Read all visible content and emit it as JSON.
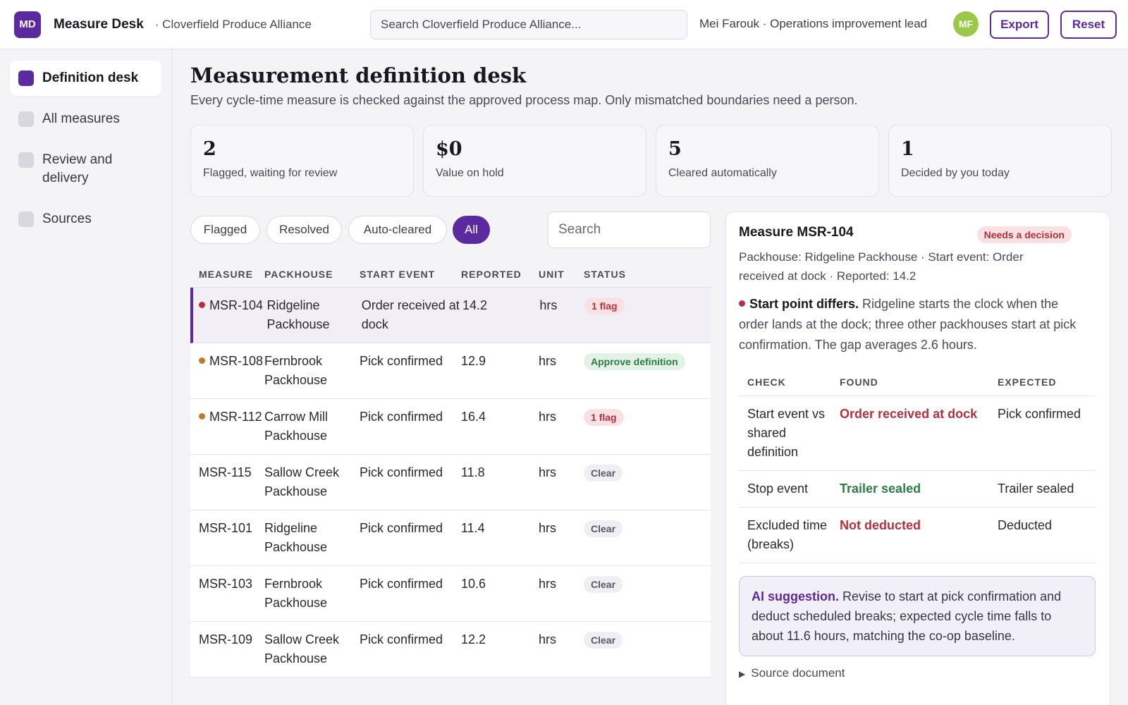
{
  "app": {
    "logo_text": "MD",
    "title": "Measure Desk",
    "org": "· Cloverfield Produce Alliance",
    "search_placeholder": "Search Cloverfield Produce Alliance...",
    "user": "Mei Farouk · Operations improvement lead",
    "avatar": "MF",
    "export_label": "Export",
    "reset_label": "Reset"
  },
  "sidebar": {
    "items": [
      {
        "label": "Definition desk",
        "active": true
      },
      {
        "label": "All measures",
        "active": false
      },
      {
        "label": "Review and delivery",
        "active": false
      },
      {
        "label": "Sources",
        "active": false
      }
    ]
  },
  "page": {
    "title": "Measurement definition desk",
    "subtitle": "Every cycle-time measure is checked against the approved process map. Only mismatched boundaries need a person."
  },
  "stats": [
    {
      "value": "2",
      "label": "Flagged, waiting for review"
    },
    {
      "value": "$0",
      "label": "Value on hold"
    },
    {
      "value": "5",
      "label": "Cleared automatically"
    },
    {
      "value": "1",
      "label": "Decided by you today"
    }
  ],
  "filters": {
    "chips": [
      "Flagged",
      "Resolved",
      "Auto-cleared",
      "All"
    ],
    "active": "All",
    "search_placeholder": "Search"
  },
  "table": {
    "headers": [
      "MEASURE",
      "PACKHOUSE",
      "START EVENT",
      "REPORTED",
      "UNIT",
      "STATUS"
    ],
    "rows": [
      {
        "measure": "MSR-104",
        "packhouse": "Ridgeline Packhouse",
        "start": "Order received at dock",
        "reported": "14.2",
        "unit": "hrs",
        "status": "1 flag",
        "status_kind": "flag",
        "dot": "red",
        "selected": true
      },
      {
        "measure": "MSR-108",
        "packhouse": "Fernbrook Packhouse",
        "start": "Pick confirmed",
        "reported": "12.9",
        "unit": "hrs",
        "status": "Approve definition",
        "status_kind": "approve",
        "dot": "amber",
        "selected": false
      },
      {
        "measure": "MSR-112",
        "packhouse": "Carrow Mill Packhouse",
        "start": "Pick confirmed",
        "reported": "16.4",
        "unit": "hrs",
        "status": "1 flag",
        "status_kind": "flag",
        "dot": "amber",
        "selected": false
      },
      {
        "measure": "MSR-115",
        "packhouse": "Sallow Creek Packhouse",
        "start": "Pick confirmed",
        "reported": "11.8",
        "unit": "hrs",
        "status": "Clear",
        "status_kind": "clear",
        "dot": "",
        "selected": false
      },
      {
        "measure": "MSR-101",
        "packhouse": "Ridgeline Packhouse",
        "start": "Pick confirmed",
        "reported": "11.4",
        "unit": "hrs",
        "status": "Clear",
        "status_kind": "clear",
        "dot": "",
        "selected": false
      },
      {
        "measure": "MSR-103",
        "packhouse": "Fernbrook Packhouse",
        "start": "Pick confirmed",
        "reported": "10.6",
        "unit": "hrs",
        "status": "Clear",
        "status_kind": "clear",
        "dot": "",
        "selected": false
      },
      {
        "measure": "MSR-109",
        "packhouse": "Sallow Creek Packhouse",
        "start": "Pick confirmed",
        "reported": "12.2",
        "unit": "hrs",
        "status": "Clear",
        "status_kind": "clear",
        "dot": "",
        "selected": false
      }
    ]
  },
  "detail": {
    "title": "Measure MSR-104",
    "badge": "Needs a decision",
    "meta": "Packhouse: Ridgeline Packhouse · Start event: Order received at dock · Reported: 14.2",
    "finding_title": "Start point differs.",
    "finding_text": " Ridgeline starts the clock when the order lands at the dock; three other packhouses start at pick confirmation. The gap averages 2.6 hours.",
    "checks_headers": [
      "CHECK",
      "FOUND",
      "EXPECTED"
    ],
    "checks": [
      {
        "check": "Start event vs shared definition",
        "found": "Order received at dock",
        "found_kind": "bad",
        "expected": "Pick confirmed"
      },
      {
        "check": "Stop event",
        "found": "Trailer sealed",
        "found_kind": "good",
        "expected": "Trailer sealed"
      },
      {
        "check": "Excluded time (breaks)",
        "found": "Not deducted",
        "found_kind": "bad",
        "expected": "Deducted"
      }
    ],
    "ai_title": "AI suggestion.",
    "ai_text": " Revise to start at pick confirmation and deduct scheduled breaks; expected cycle time falls to about 11.6 hours, matching the co-op baseline.",
    "source_label": "Source document"
  },
  "colors": {
    "accent": "#5b2a9e",
    "danger": "#b3303e",
    "success": "#2e7d46",
    "warning": "#c07a2e"
  }
}
